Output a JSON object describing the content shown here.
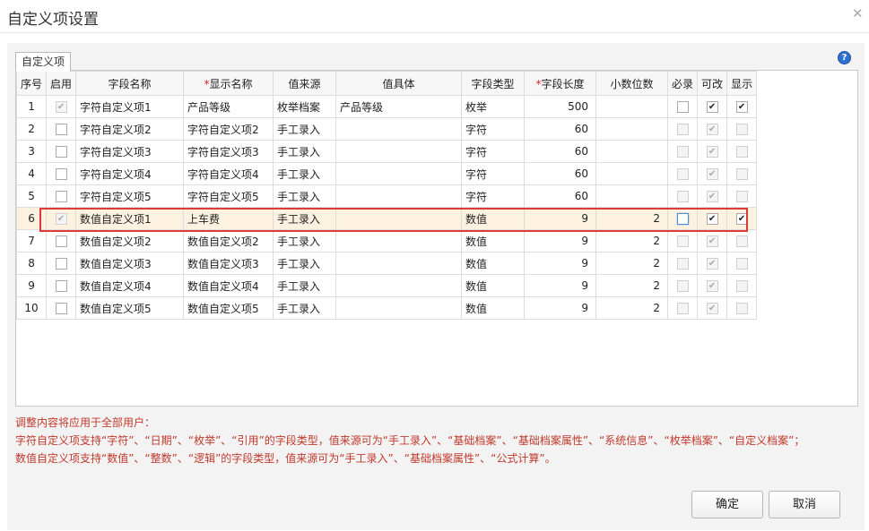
{
  "dialog": {
    "title": "自定义项设置",
    "close_icon": "close-icon"
  },
  "tab": {
    "label": "自定义项"
  },
  "help_icon": "help-icon",
  "columns": {
    "seq": "序号",
    "enabled": "启用",
    "field_name": "字段名称",
    "display_name": "显示名称",
    "value_source": "值来源",
    "value_detail": "值具体",
    "field_type": "字段类型",
    "field_length": "字段长度",
    "decimals": "小数位数",
    "required": "必录",
    "editable": "可改",
    "visible": "显示"
  },
  "required_mark": "*",
  "rows": [
    {
      "seq": "1",
      "field_name": "字符自定义项1",
      "display_name": "产品等级",
      "value_source": "枚举档案",
      "value_detail": "产品等级",
      "field_type": "枚举",
      "field_length": "500",
      "decimals": "",
      "enabled": {
        "checked": true,
        "disabled": true
      },
      "required": {
        "checked": false,
        "disabled": false
      },
      "editable": {
        "checked": true,
        "disabled": false
      },
      "visible": {
        "checked": true,
        "disabled": false
      }
    },
    {
      "seq": "2",
      "field_name": "字符自定义项2",
      "display_name": "字符自定义项2",
      "value_source": "手工录入",
      "value_detail": "",
      "field_type": "字符",
      "field_length": "60",
      "decimals": "",
      "enabled": {
        "checked": false,
        "disabled": false
      },
      "required": {
        "checked": false,
        "disabled": true
      },
      "editable": {
        "checked": true,
        "disabled": true
      },
      "visible": {
        "checked": false,
        "disabled": true
      }
    },
    {
      "seq": "3",
      "field_name": "字符自定义项3",
      "display_name": "字符自定义项3",
      "value_source": "手工录入",
      "value_detail": "",
      "field_type": "字符",
      "field_length": "60",
      "decimals": "",
      "enabled": {
        "checked": false,
        "disabled": false
      },
      "required": {
        "checked": false,
        "disabled": true
      },
      "editable": {
        "checked": true,
        "disabled": true
      },
      "visible": {
        "checked": false,
        "disabled": true
      }
    },
    {
      "seq": "4",
      "field_name": "字符自定义项4",
      "display_name": "字符自定义项4",
      "value_source": "手工录入",
      "value_detail": "",
      "field_type": "字符",
      "field_length": "60",
      "decimals": "",
      "enabled": {
        "checked": false,
        "disabled": false
      },
      "required": {
        "checked": false,
        "disabled": true
      },
      "editable": {
        "checked": true,
        "disabled": true
      },
      "visible": {
        "checked": false,
        "disabled": true
      }
    },
    {
      "seq": "5",
      "field_name": "字符自定义项5",
      "display_name": "字符自定义项5",
      "value_source": "手工录入",
      "value_detail": "",
      "field_type": "字符",
      "field_length": "60",
      "decimals": "",
      "enabled": {
        "checked": false,
        "disabled": false
      },
      "required": {
        "checked": false,
        "disabled": true
      },
      "editable": {
        "checked": true,
        "disabled": true
      },
      "visible": {
        "checked": false,
        "disabled": true
      }
    },
    {
      "seq": "6",
      "field_name": "数值自定义项1",
      "display_name": "上车费",
      "value_source": "手工录入",
      "value_detail": "",
      "field_type": "数值",
      "field_length": "9",
      "decimals": "2",
      "enabled": {
        "checked": true,
        "disabled": true
      },
      "required": {
        "checked": false,
        "disabled": false,
        "focus": true
      },
      "editable": {
        "checked": true,
        "disabled": false
      },
      "visible": {
        "checked": true,
        "disabled": false
      },
      "highlighted": true
    },
    {
      "seq": "7",
      "field_name": "数值自定义项2",
      "display_name": "数值自定义项2",
      "value_source": "手工录入",
      "value_detail": "",
      "field_type": "数值",
      "field_length": "9",
      "decimals": "2",
      "enabled": {
        "checked": false,
        "disabled": false
      },
      "required": {
        "checked": false,
        "disabled": true
      },
      "editable": {
        "checked": true,
        "disabled": true
      },
      "visible": {
        "checked": false,
        "disabled": true
      }
    },
    {
      "seq": "8",
      "field_name": "数值自定义项3",
      "display_name": "数值自定义项3",
      "value_source": "手工录入",
      "value_detail": "",
      "field_type": "数值",
      "field_length": "9",
      "decimals": "2",
      "enabled": {
        "checked": false,
        "disabled": false
      },
      "required": {
        "checked": false,
        "disabled": true
      },
      "editable": {
        "checked": true,
        "disabled": true
      },
      "visible": {
        "checked": false,
        "disabled": true
      }
    },
    {
      "seq": "9",
      "field_name": "数值自定义项4",
      "display_name": "数值自定义项4",
      "value_source": "手工录入",
      "value_detail": "",
      "field_type": "数值",
      "field_length": "9",
      "decimals": "2",
      "enabled": {
        "checked": false,
        "disabled": false
      },
      "required": {
        "checked": false,
        "disabled": true
      },
      "editable": {
        "checked": true,
        "disabled": true
      },
      "visible": {
        "checked": false,
        "disabled": true
      }
    },
    {
      "seq": "10",
      "field_name": "数值自定义项5",
      "display_name": "数值自定义项5",
      "value_source": "手工录入",
      "value_detail": "",
      "field_type": "数值",
      "field_length": "9",
      "decimals": "2",
      "enabled": {
        "checked": false,
        "disabled": false
      },
      "required": {
        "checked": false,
        "disabled": true
      },
      "editable": {
        "checked": true,
        "disabled": true
      },
      "visible": {
        "checked": false,
        "disabled": true
      }
    }
  ],
  "notes": [
    "调整内容将应用于全部用户：",
    "字符自定义项支持“字符”、“日期”、“枚举”、“引用”的字段类型，值来源可为“手工录入”、“基础档案”、“基础档案属性”、“系统信息”、“枚举档案”、“自定义档案”；",
    "数值自定义项支持“数值”、“整数”、“逻辑”的字段类型，值来源可为“手工录入”、“基础档案属性”、“公式计算”。"
  ],
  "buttons": {
    "ok": "确定",
    "cancel": "取消"
  },
  "colors": {
    "highlight_border": "#e03b3b",
    "note_text": "#c0392b",
    "help_blue": "#2f6fd0"
  }
}
